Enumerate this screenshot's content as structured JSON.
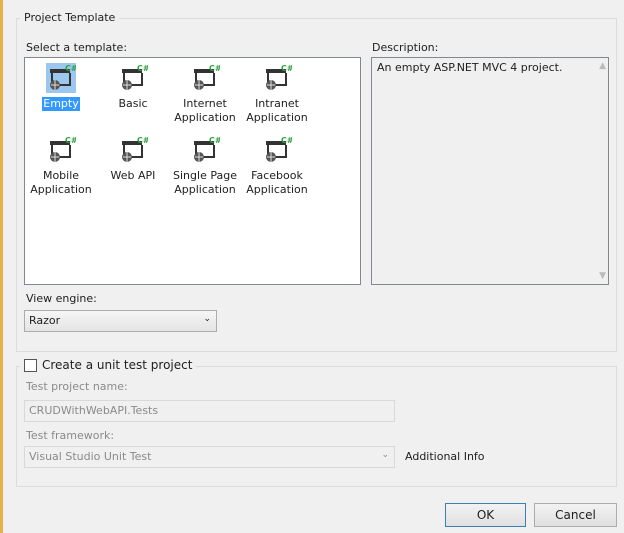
{
  "project_template": {
    "title": "Project Template",
    "select_label": "Select a template:",
    "templates": [
      {
        "label1": "Empty",
        "label2": ""
      },
      {
        "label1": "Basic",
        "label2": ""
      },
      {
        "label1": "Internet",
        "label2": "Application"
      },
      {
        "label1": "Intranet",
        "label2": "Application"
      },
      {
        "label1": "Mobile",
        "label2": "Application"
      },
      {
        "label1": "Web API",
        "label2": ""
      },
      {
        "label1": "Single Page",
        "label2": "Application"
      },
      {
        "label1": "Facebook",
        "label2": "Application"
      }
    ],
    "selected": "Empty",
    "description_label": "Description:",
    "description": "An empty ASP.NET MVC 4 project.",
    "view_engine_label": "View engine:",
    "view_engine": "Razor"
  },
  "unit_test": {
    "checkbox_label": "Create a unit test project",
    "checked": false,
    "project_name_label": "Test project name:",
    "project_name": "CRUDWithWebAPI.Tests",
    "framework_label": "Test framework:",
    "framework": "Visual Studio Unit Test",
    "additional_info": "Additional Info"
  },
  "buttons": {
    "ok": "OK",
    "cancel": "Cancel"
  },
  "colors": {
    "selection": "#3399ff",
    "csharp_badge": "#2e9e3e"
  }
}
